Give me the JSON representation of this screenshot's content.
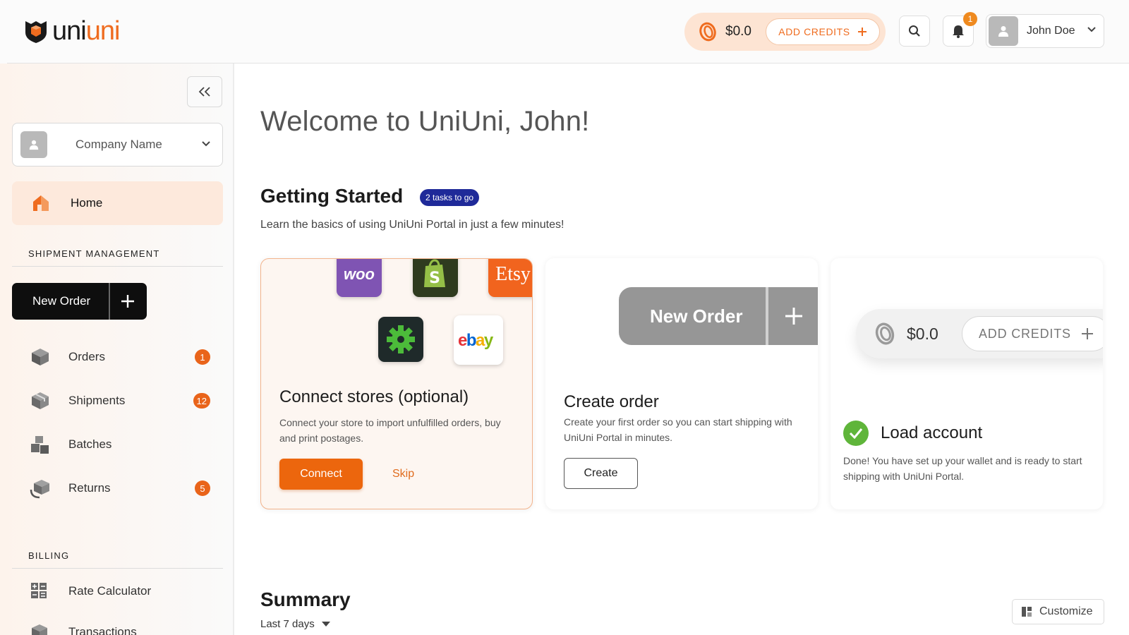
{
  "app": {
    "logo_part1": "uni",
    "logo_part2": "uni"
  },
  "header": {
    "wallet_amount": "$0.0",
    "add_credits_label": "ADD CREDITS",
    "notification_count": "1",
    "user_name": "John Doe"
  },
  "sidebar": {
    "company_name": "Company Name",
    "home_label": "Home",
    "section_shipment": "SHIPMENT MANAGEMENT",
    "new_order_label": "New Order",
    "items": [
      {
        "label": "Orders",
        "badge": "1",
        "icon": "orders-box-icon"
      },
      {
        "label": "Shipments",
        "badge": "12",
        "icon": "shipments-box-icon"
      },
      {
        "label": "Batches",
        "badge": "",
        "icon": "batches-boxes-icon"
      },
      {
        "label": "Returns",
        "badge": "5",
        "icon": "returns-box-icon"
      }
    ],
    "section_billing": "BILLING",
    "billing_items": [
      {
        "label": "Rate Calculator",
        "icon": "calculator-grid-icon"
      },
      {
        "label": "Transactions",
        "icon": "transactions-icon"
      }
    ]
  },
  "main": {
    "welcome": "Welcome to UniUni, John!",
    "getting_started_title": "Getting Started",
    "tasks_badge": "2 tasks to go",
    "getting_started_sub": "Learn the basics of using UniUni Portal in just a few minutes!",
    "cards": {
      "connect": {
        "title": "Connect stores (optional)",
        "desc": "Connect your store to import unfulfilled orders, buy and print postages.",
        "connect_label": "Connect",
        "skip_label": "Skip",
        "store_logos": {
          "woo": "woo",
          "etsy": "Etsy"
        }
      },
      "create": {
        "title": "Create order",
        "desc": "Create your first order so you can start shipping with UniUni Portal in minutes.",
        "create_label": "Create",
        "demo_button_label": "New Order"
      },
      "load": {
        "title": "Load account",
        "desc": "Done! You have set up your wallet and is ready to start shipping with UniUni Portal.",
        "demo_amount": "$0.0",
        "demo_add_label": "ADD CREDITS"
      }
    },
    "summary_title": "Summary",
    "period_label": "Last 7 days",
    "customize_label": "Customize"
  },
  "colors": {
    "accent": "#ec660d",
    "dark": "#0e0e0e",
    "badge_blue": "#1f2a99",
    "success": "#5fb53a"
  }
}
